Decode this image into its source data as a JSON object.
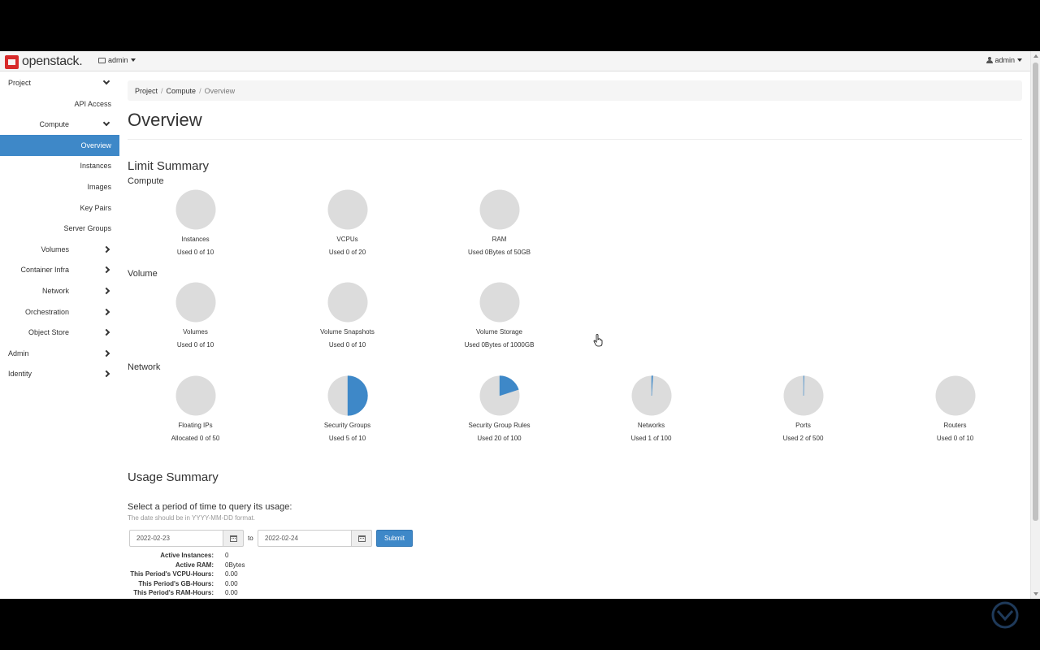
{
  "header": {
    "brand": "openstack.",
    "project_switcher": "admin",
    "user_menu": "admin"
  },
  "sidebar": {
    "items": [
      {
        "label": "Project",
        "level": 1,
        "chevron": "down"
      },
      {
        "label": "API Access",
        "level": 3
      },
      {
        "label": "Compute",
        "level": 2,
        "chevron": "down"
      },
      {
        "label": "Overview",
        "level": 3,
        "active": true
      },
      {
        "label": "Instances",
        "level": 3
      },
      {
        "label": "Images",
        "level": 3
      },
      {
        "label": "Key Pairs",
        "level": 3
      },
      {
        "label": "Server Groups",
        "level": 3
      },
      {
        "label": "Volumes",
        "level": 2,
        "chevron": "right"
      },
      {
        "label": "Container Infra",
        "level": 2,
        "chevron": "right"
      },
      {
        "label": "Network",
        "level": 2,
        "chevron": "right"
      },
      {
        "label": "Orchestration",
        "level": 2,
        "chevron": "right"
      },
      {
        "label": "Object Store",
        "level": 2,
        "chevron": "right"
      },
      {
        "label": "Admin",
        "level": 1,
        "chevron": "right"
      },
      {
        "label": "Identity",
        "level": 1,
        "chevron": "right"
      }
    ]
  },
  "breadcrumb": [
    "Project",
    "Compute",
    "Overview"
  ],
  "page_title": "Overview",
  "limit_summary": {
    "title": "Limit Summary",
    "groups": [
      {
        "title": "Compute",
        "charts": [
          {
            "name": "Instances",
            "used_text": "Used 0 of 10",
            "fraction": 0
          },
          {
            "name": "VCPUs",
            "used_text": "Used 0 of 20",
            "fraction": 0
          },
          {
            "name": "RAM",
            "used_text": "Used 0Bytes of 50GB",
            "fraction": 0
          }
        ]
      },
      {
        "title": "Volume",
        "charts": [
          {
            "name": "Volumes",
            "used_text": "Used 0 of 10",
            "fraction": 0
          },
          {
            "name": "Volume Snapshots",
            "used_text": "Used 0 of 10",
            "fraction": 0
          },
          {
            "name": "Volume Storage",
            "used_text": "Used 0Bytes of 1000GB",
            "fraction": 0
          }
        ]
      },
      {
        "title": "Network",
        "charts": [
          {
            "name": "Floating IPs",
            "used_text": "Allocated 0 of 50",
            "fraction": 0
          },
          {
            "name": "Security Groups",
            "used_text": "Used 5 of 10",
            "fraction": 0.5
          },
          {
            "name": "Security Group Rules",
            "used_text": "Used 20 of 100",
            "fraction": 0.2
          },
          {
            "name": "Networks",
            "used_text": "Used 1 of 100",
            "fraction": 0.01
          },
          {
            "name": "Ports",
            "used_text": "Used 2 of 500",
            "fraction": 0.004
          },
          {
            "name": "Routers",
            "used_text": "Used 0 of 10",
            "fraction": 0
          }
        ]
      }
    ]
  },
  "usage_summary": {
    "title": "Usage Summary",
    "prompt": "Select a period of time to query its usage:",
    "help": "The date should be in YYYY-MM-DD format.",
    "start_date": "2022-02-23",
    "to_label": "to",
    "end_date": "2022-02-24",
    "submit_label": "Submit",
    "stats": [
      {
        "label": "Active Instances:",
        "value": "0"
      },
      {
        "label": "Active RAM:",
        "value": "0Bytes"
      },
      {
        "label": "This Period's VCPU-Hours:",
        "value": "0.00"
      },
      {
        "label": "This Period's GB-Hours:",
        "value": "0.00"
      },
      {
        "label": "This Period's RAM-Hours:",
        "value": "0.00"
      }
    ]
  },
  "colors": {
    "accent": "#3e88c8",
    "pie_empty": "#dcdcdc",
    "brand_red": "#d72a2a"
  }
}
